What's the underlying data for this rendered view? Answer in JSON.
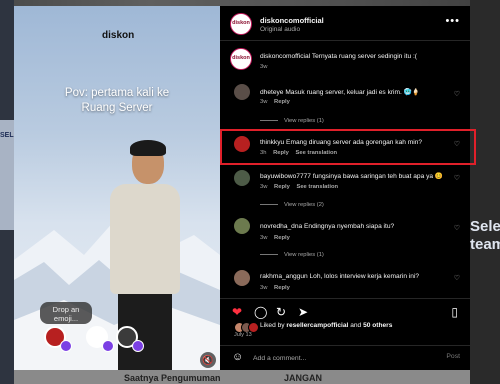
{
  "background": {
    "left_text": "SELE",
    "right_text": "Sele\nteam",
    "bottom_text_1": "Saatnya Pengumuman",
    "bottom_text_2": "JANGAN"
  },
  "media": {
    "brand": "diskon",
    "caption_line1": "Pov: pertama kali ke",
    "caption_line2": "Ruang Server",
    "emoji_chip": "Drop an\nemoji...",
    "mute_icon": "speaker-muted-icon"
  },
  "post": {
    "username": "diskoncomofficial",
    "audio": "Original audio",
    "avatar_text": "diskon",
    "caption": "Ternyata ruang server sedingin itu :(",
    "caption_time": "3w"
  },
  "comments": [
    {
      "user": "dheteye",
      "text": "Masuk ruang server, keluar jadi es krim. 🥶🍦",
      "time": "3w",
      "reply": "Reply",
      "avatar_color": "#5a4e48"
    },
    {
      "user": "thinkkyu",
      "text": "Emang diruang server ada gorengan kah min?",
      "time": "3h",
      "reply": "Reply",
      "translate": "See translation",
      "avatar_color": "#b72020"
    },
    {
      "user": "bayuwibowo7777",
      "text": "fungsinya bawa saringan teh buat apa ya 😊",
      "time": "3w",
      "reply": "Reply",
      "translate": "See translation",
      "avatar_color": "#4d5b47"
    },
    {
      "user": "novredha_dna",
      "text": "Endingnya nyembah siapa itu?",
      "time": "3w",
      "reply": "Reply",
      "avatar_color": "#6c7a4e"
    },
    {
      "user": "rakhma_anggun",
      "text": "Loh, lolos interview kerja kemarin ini?",
      "time": "3w",
      "reply": "Reply",
      "avatar_color": "#8a6a5a"
    }
  ],
  "view_replies": [
    "View replies (1)",
    "View replies (2)",
    "View replies (1)"
  ],
  "likes": {
    "prefix": "Liked by",
    "user": "resellercampofficial",
    "connector": "and",
    "others": "50 others"
  },
  "date": "July 13",
  "composer": {
    "placeholder": "Add a comment...",
    "post": "Post"
  }
}
